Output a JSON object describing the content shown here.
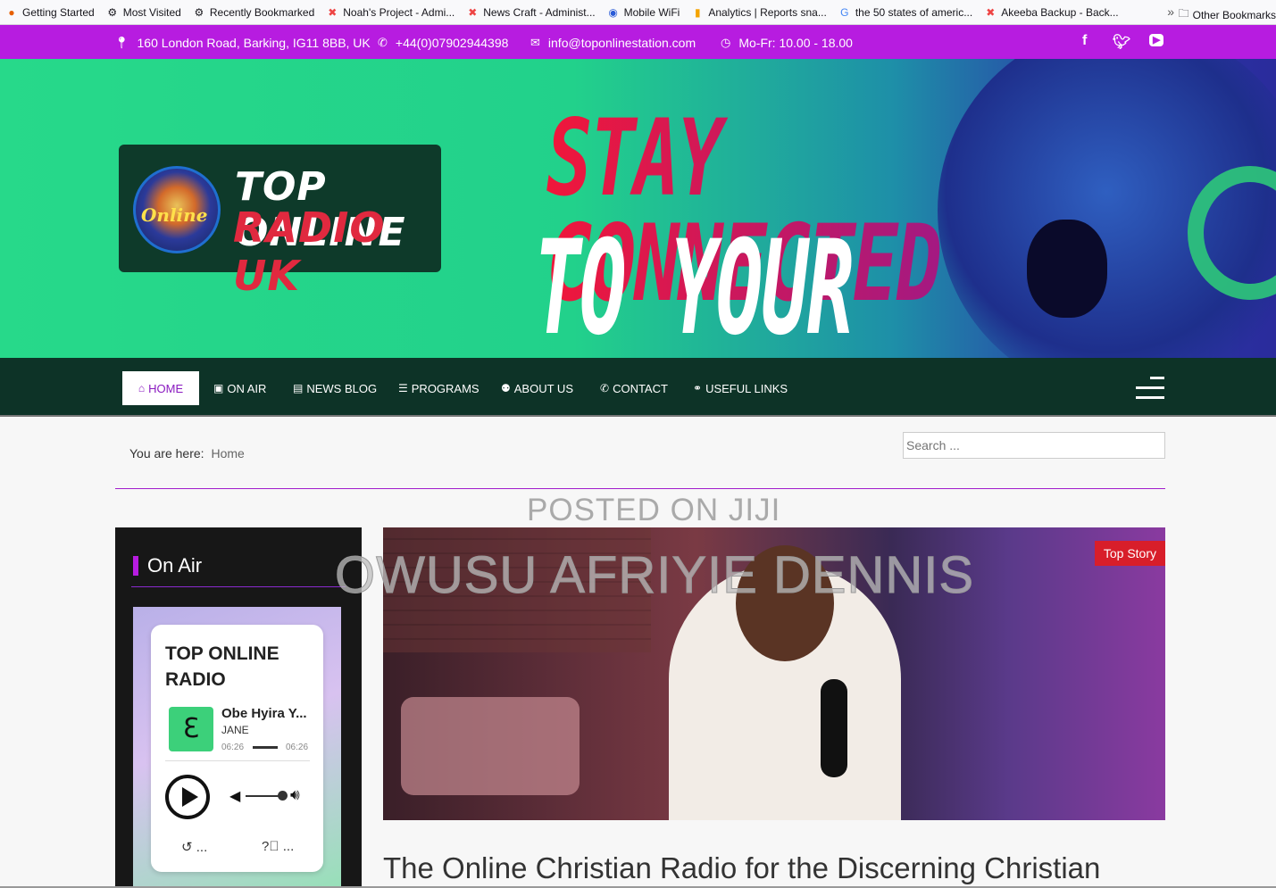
{
  "bookmarks": {
    "items": [
      {
        "label": "Getting Started",
        "icon": "firefox-icon"
      },
      {
        "label": "Most Visited",
        "icon": "gear-icon"
      },
      {
        "label": "Recently Bookmarked",
        "icon": "gear-icon"
      },
      {
        "label": "Noah's Project - Admi...",
        "icon": "joomla-icon"
      },
      {
        "label": "News Craft - Administ...",
        "icon": "joomla-icon"
      },
      {
        "label": "Mobile WiFi",
        "icon": "globe-icon"
      },
      {
        "label": "Analytics | Reports sna...",
        "icon": "analytics-icon"
      },
      {
        "label": "the 50 states of americ...",
        "icon": "google-icon"
      },
      {
        "label": "Akeeba Backup - Back...",
        "icon": "joomla-icon"
      }
    ],
    "more": "»",
    "other": "Other Bookmarks"
  },
  "topbar": {
    "address": "160 London Road, Barking, IG11 8BB, UK",
    "phone": "+44(0)07902944398",
    "email": "info@toponlinestation.com",
    "hours": "Mo-Fr: 10.00 - 18.00",
    "social": [
      "facebook-icon",
      "twitter-icon",
      "youtube-icon"
    ]
  },
  "hero": {
    "logo_line1": "TOP ONLINE",
    "logo_line2": "RADIO UK",
    "logo_badge": "Online",
    "slogan_line1": "STAY CONNECTED",
    "slogan_line2": "TO YOUR FAITH"
  },
  "nav": {
    "items": [
      {
        "label": "HOME",
        "icon": "home-icon"
      },
      {
        "label": "ON AIR",
        "icon": "radio-icon"
      },
      {
        "label": "NEWS BLOG",
        "icon": "newspaper-icon"
      },
      {
        "label": "PROGRAMS",
        "icon": "list-icon"
      },
      {
        "label": "ABOUT US",
        "icon": "users-icon"
      },
      {
        "label": "CONTACT",
        "icon": "phone-icon"
      },
      {
        "label": "USEFUL LINKS",
        "icon": "link-icon"
      }
    ]
  },
  "breadcrumb": {
    "prefix": "You are here:",
    "current": "Home"
  },
  "search": {
    "placeholder": "Search ..."
  },
  "watermark": {
    "line1": "POSTED ON JIJI",
    "line2": "OWUSU AFRIYIE DENNIS"
  },
  "sidebar": {
    "title": "On Air",
    "player": {
      "title": "TOP ONLINE RADIO",
      "song": "Obe Hyira Y...",
      "artist": "JANE",
      "time_elapsed": "06:26",
      "time_total": "06:26",
      "history_label": "...",
      "help_label": "..."
    }
  },
  "main": {
    "badge": "Top Story",
    "headline": "The Online Christian Radio for the Discerning Christian"
  },
  "colors": {
    "accent": "#b71ce0",
    "nav_bg": "#0d3327",
    "hero_green": "#27d98a",
    "badge": "#d81e2a"
  }
}
